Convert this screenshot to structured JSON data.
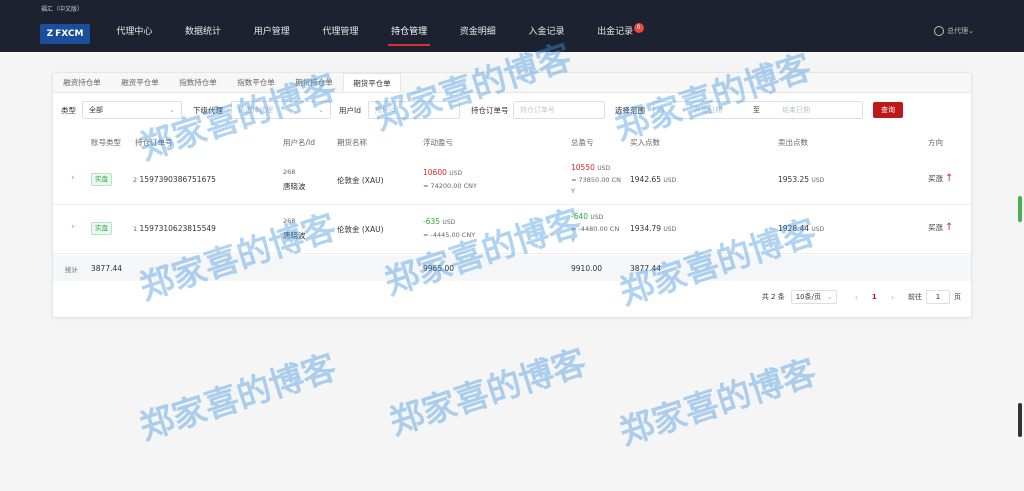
{
  "header": {
    "tiny_title": "福汇（中文版）",
    "logo_text": "FXCM",
    "nav": [
      {
        "label": "代理中心"
      },
      {
        "label": "数据统计"
      },
      {
        "label": "用户管理"
      },
      {
        "label": "代理管理"
      },
      {
        "label": "持仓管理",
        "active": true
      },
      {
        "label": "资金明细"
      },
      {
        "label": "入金记录"
      },
      {
        "label": "出金记录",
        "badge": "0"
      }
    ],
    "user_label": "总代理"
  },
  "tabs": [
    "融资持仓单",
    "融资平仓单",
    "指数持仓单",
    "指数平仓单",
    "期货持仓单",
    "期货平仓单"
  ],
  "filters": {
    "type_label": "类型",
    "type_value": "全部",
    "agent_label": "下级代理",
    "agent_placeholder": "请选择代理",
    "userid_label": "用户Id",
    "userid_placeholder": "用户Id",
    "order_label": "持仓订单号",
    "order_placeholder": "持仓订单号",
    "range_label": "选择范围",
    "range_start": "开始日期",
    "range_sep": "至",
    "range_end": "结束日期",
    "query_label": "查询"
  },
  "table": {
    "headers": [
      "账号类型",
      "持仓订单号",
      "用户名/Id",
      "期货名称",
      "浮动盈亏",
      "总盈亏",
      "买入点数",
      "卖出点数",
      "方向"
    ],
    "rows": [
      {
        "account_type": "实盘",
        "idx": "2",
        "order": "1597390386751675",
        "user_id": "268",
        "user_name": "唐晓波",
        "product": "伦敦金 (XAU)",
        "float_pl": "10600",
        "float_cur": "USD",
        "float_cny": "≈ 74200.00 CNY",
        "total_pl": "10550",
        "total_cur": "USD",
        "total_cny": "≈ 73850.00 CN",
        "total_cny2": "Y",
        "buy": "1942.65",
        "buy_cur": "USD",
        "sell": "1953.25",
        "sell_cur": "USD",
        "direction": "买涨",
        "sign": "positive"
      },
      {
        "account_type": "实盘",
        "idx": "1",
        "order": "1597310623815549",
        "user_id": "268",
        "user_name": "唐晓波",
        "product": "伦敦金 (XAU)",
        "float_pl": "-635",
        "float_cur": "USD",
        "float_cny": "≈ -4445.00 CNY",
        "total_pl": "-640",
        "total_cur": "USD",
        "total_cny": "≈ -4480.00 CN",
        "total_cny2": "Y",
        "buy": "1934.79",
        "buy_cur": "USD",
        "sell": "1928.44",
        "sell_cur": "USD",
        "direction": "买涨",
        "sign": "negative"
      }
    ],
    "summary": {
      "label": "统计",
      "a": "3877.44",
      "b": "9965.00",
      "c": "9910.00",
      "d": "3877.44"
    }
  },
  "pager": {
    "total": "共 2 条",
    "page_size": "10条/页",
    "prev": "‹",
    "current": "1",
    "next": "›",
    "goto_label": "前往",
    "goto_value": "1",
    "goto_suffix": "页"
  },
  "watermark": "郑家喜的博客",
  "colors": {
    "accent": "#c0181a",
    "topbar": "#1d2230",
    "profit": "#e02525",
    "loss": "#2aa845"
  }
}
